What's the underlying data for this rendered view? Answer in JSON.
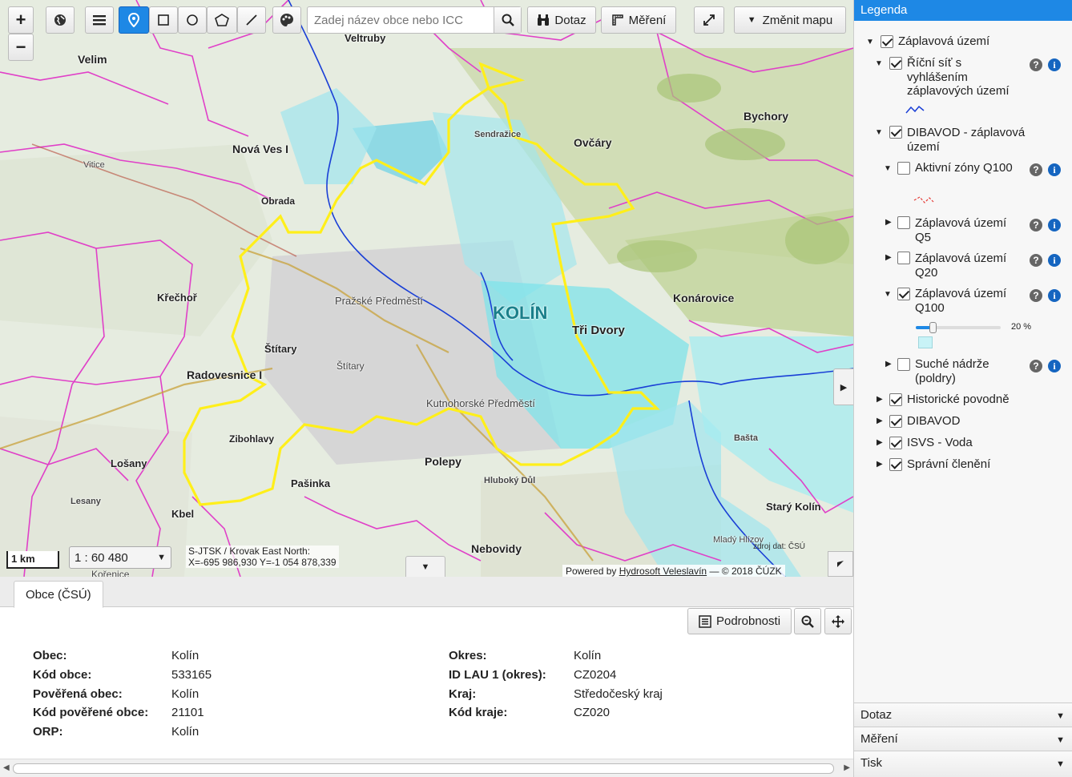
{
  "toolbar": {
    "zoom_in": "+",
    "zoom_out": "−",
    "search_placeholder": "Zadej název obce nebo ICC",
    "dotaz_label": "Dotaz",
    "mereni_label": "Měření",
    "zmenit_mapu_label": "Změnit mapu",
    "icons": [
      "globe-icon",
      "menu-icon",
      "point-tool-icon",
      "rectangle-tool-icon",
      "circle-tool-icon",
      "polygon-tool-icon",
      "line-tool-icon",
      "palette-icon",
      "search-icon",
      "binoculars-icon",
      "ruler-icon",
      "fullscreen-icon",
      "dropdown-arrow-icon"
    ]
  },
  "map": {
    "scale_bar": "1 km",
    "scale_value": "1 : 60 480",
    "coords_line1": "S-JTSK / Krovak East North:",
    "coords_line2": "X=-695 986,930 Y=-1 054 878,339",
    "attribution_prefix": "Powered by",
    "attribution_link": "Hydrosoft Veleslavín",
    "attribution_suffix": "— © 2018 ČÚZK",
    "source_note": "zdroj dat: ČSÚ",
    "colors": {
      "flood": "#7fe3ea",
      "municipality_border": "#ffef1a",
      "district_border": "#e040c8",
      "river": "#1a3fd6"
    },
    "labels": [
      {
        "t": "Velim"
      },
      {
        "t": "Veltruby"
      },
      {
        "t": "Nová Ves I"
      },
      {
        "t": "Ovčáry"
      },
      {
        "t": "Bychory"
      },
      {
        "t": "Sendražice"
      },
      {
        "t": "Obrada"
      },
      {
        "t": "Konárovice"
      },
      {
        "t": "KOLÍN"
      },
      {
        "t": "Tři Dvory"
      },
      {
        "t": "Štítary"
      },
      {
        "t": "Radovesnice I"
      },
      {
        "t": "Křečhoř"
      },
      {
        "t": "Zibohlavy"
      },
      {
        "t": "Lošany"
      },
      {
        "t": "Pašinka"
      },
      {
        "t": "Polepy"
      },
      {
        "t": "Nebovidy"
      },
      {
        "t": "Starý Kolín"
      },
      {
        "t": "Hluboký Důl"
      },
      {
        "t": "Kbel"
      },
      {
        "t": "Kutnohorské Předměstí"
      },
      {
        "t": "Pražské Předměstí"
      },
      {
        "t": "Štítary"
      },
      {
        "t": "Vitice"
      },
      {
        "t": "Kořenice"
      },
      {
        "t": "Mladý Hlízov"
      },
      {
        "t": "Bašta"
      },
      {
        "t": "Lesany"
      }
    ]
  },
  "bottom": {
    "tab_label": "Obce (ČSÚ)",
    "podrobnosti_label": "Podrobnosti",
    "left": [
      {
        "k": "Obec",
        "v": "Kolín"
      },
      {
        "k": "Kód obce",
        "v": "533165"
      },
      {
        "k": "Pověřená obec",
        "v": "Kolín"
      },
      {
        "k": "Kód pověřené obce",
        "v": "21101"
      },
      {
        "k": "ORP",
        "v": "Kolín"
      }
    ],
    "right": [
      {
        "k": "Okres",
        "v": "Kolín"
      },
      {
        "k": "ID LAU 1 (okres)",
        "v": "CZ0204"
      },
      {
        "k": "Kraj",
        "v": "Středočeský kraj"
      },
      {
        "k": "Kód kraje",
        "v": "CZ020"
      }
    ]
  },
  "legend": {
    "title": "Legenda",
    "items": [
      {
        "label": "Záplavová území",
        "checked": true
      },
      {
        "label": "Říční síť s vyhlášením záplavových území",
        "checked": true
      },
      {
        "label": "DIBAVOD - záplavová území",
        "checked": true
      },
      {
        "label": "Aktivní zóny Q100",
        "checked": false
      },
      {
        "label": "Záplavová území Q5",
        "checked": false
      },
      {
        "label": "Záplavová území Q20",
        "checked": false
      },
      {
        "label": "Záplavová území Q100",
        "checked": true
      },
      {
        "label": "Suché nádrže (poldry)",
        "checked": false
      },
      {
        "label": "Historické povodně",
        "checked": true
      },
      {
        "label": "DIBAVOD",
        "checked": true
      },
      {
        "label": "ISVS - Voda",
        "checked": true
      },
      {
        "label": "Správní členění",
        "checked": true
      }
    ],
    "opacity_label": "20 %",
    "opacity_value": 0.2,
    "accordion": [
      "Dotaz",
      "Měření",
      "Tisk"
    ]
  }
}
